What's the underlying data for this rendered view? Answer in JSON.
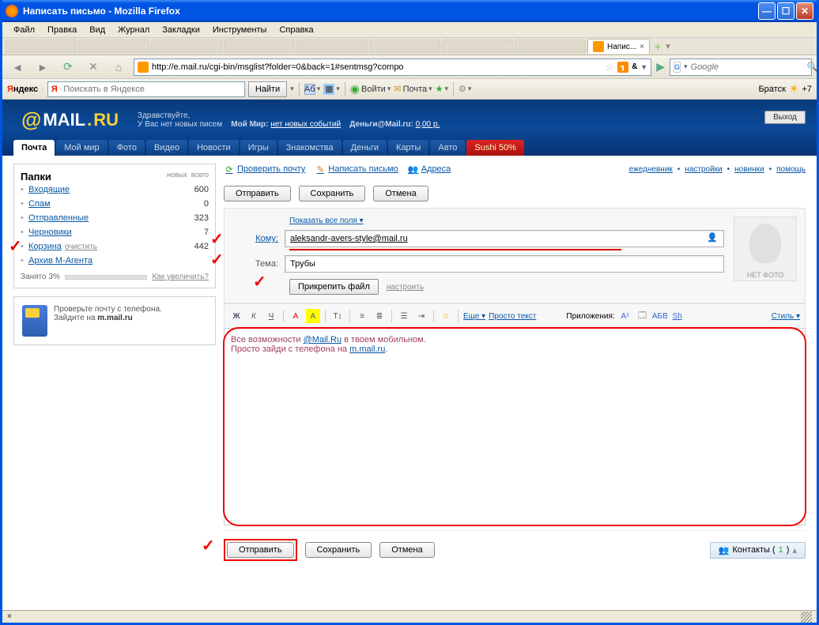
{
  "window": {
    "title": "Написать письмо - Mozilla Firefox"
  },
  "menubar": [
    "Файл",
    "Правка",
    "Вид",
    "Журнал",
    "Закладки",
    "Инструменты",
    "Справка"
  ],
  "active_tab": "Напис...",
  "url": "http://e.mail.ru/cgi-bin/msglist?folder=0&back=1#sentmsg?compo",
  "search_placeholder": "Google",
  "yandex": {
    "label": "Яндекс",
    "placeholder": "Поискать в Яндексе",
    "find": "Найти",
    "login": "Войти",
    "mail": "Почта",
    "city": "Братск",
    "temp": "+7"
  },
  "mailru": {
    "logo": {
      "at": "@",
      "name": "MAIL",
      "dot": ".",
      "tld": "RU"
    },
    "greeting": {
      "hello": "Здравствуйте,",
      "no_new": "У Вас нет новых писем",
      "my_world_label": "Мой Мир:",
      "my_world_link": "нет новых событий",
      "money_label": "Деньги@Mail.ru:",
      "money_value": "0,00 р.",
      "exit": "Выход"
    },
    "tabs": [
      "Почта",
      "Мой мир",
      "Фото",
      "Видео",
      "Новости",
      "Игры",
      "Знакомства",
      "Деньги",
      "Карты",
      "Авто"
    ],
    "promo_tab": "Sushi 50%"
  },
  "toolbar_links": {
    "check": "Проверить почту",
    "compose": "Написать письмо",
    "contacts": "Адреса",
    "right": [
      "ежедневник",
      "настройки",
      "новинки",
      "помощь"
    ]
  },
  "folders": {
    "title": "Папки",
    "cols": {
      "new": "новых",
      "total": "всего"
    },
    "items": [
      {
        "name": "Входящие",
        "count": "600"
      },
      {
        "name": "Спам",
        "count": "0"
      },
      {
        "name": "Отправленные",
        "count": "323"
      },
      {
        "name": "Черновики",
        "count": "7"
      },
      {
        "name": "Корзина",
        "clean": "очистить",
        "count": "442"
      },
      {
        "name": "Архив М-Агента",
        "count": ""
      }
    ],
    "quota": {
      "label": "Занято 3%",
      "link": "Как увеличить?"
    }
  },
  "promo": {
    "line1": "Проверьте почту с телефона.",
    "line2a": "Зайдите на ",
    "line2b": "m.mail.ru"
  },
  "buttons": {
    "send": "Отправить",
    "save": "Сохранить",
    "cancel": "Отмена"
  },
  "fields": {
    "show_all": "Показать все поля ▾",
    "to_label": "Кому:",
    "to_value": "aleksandr-avers-style@mail.ru",
    "subject_label": "Тема:",
    "subject_value": "Трубы",
    "attach": "Прикрепить файл",
    "tune": "настроить",
    "no_photo": "НЕТ ФОТО"
  },
  "editor": {
    "tb": {
      "more": "Еще ▾",
      "plain": "Просто текст",
      "apps": "Приложения:",
      "style": "Стиль ▾",
      "bold": "Ж",
      "italic": "К",
      "underline": "Ч"
    },
    "body1": "Все возможности ",
    "body_link1": "@Mail.Ru",
    "body2": " в твоем мобильном.",
    "body3": "Просто зайди с телефона на ",
    "body_link2": "m.mail.ru",
    "body4": "."
  },
  "contacts_widget": {
    "label": "Контакты (",
    "count": "1",
    "close": ")"
  }
}
